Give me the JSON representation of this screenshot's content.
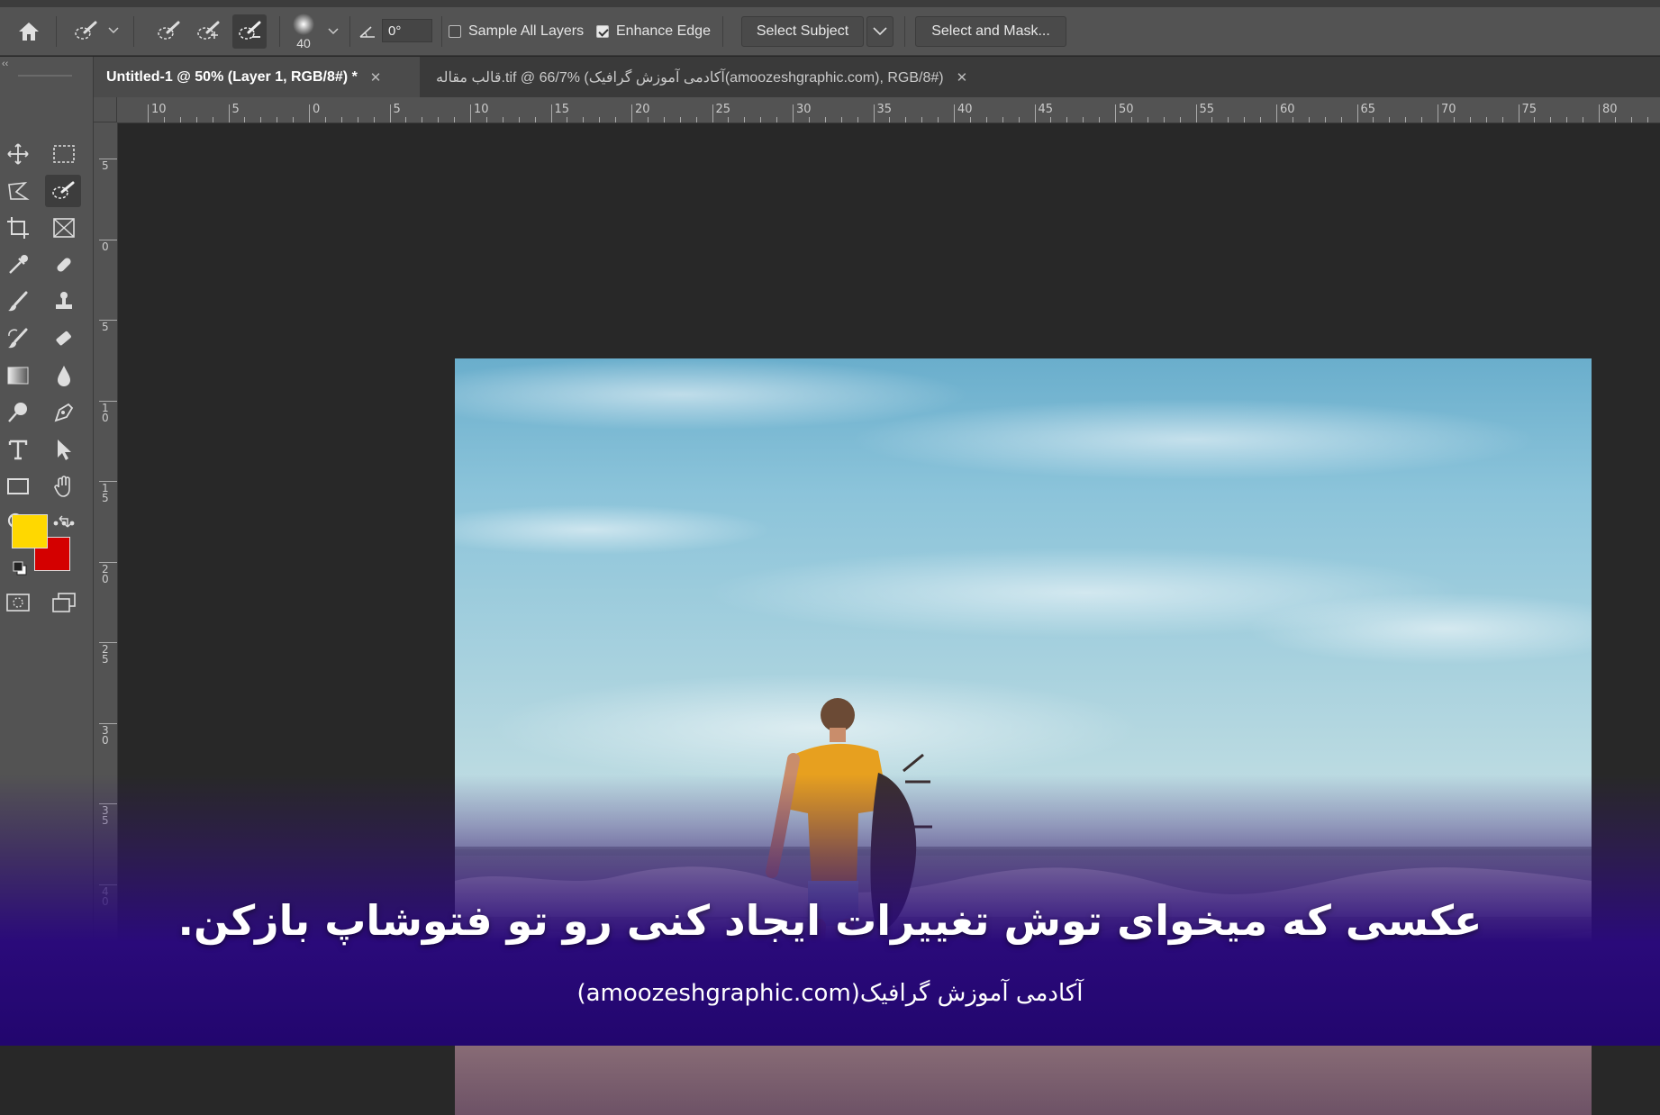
{
  "options_bar": {
    "brush_size": "40",
    "angle_value": "0°",
    "sample_all_layers_label": "Sample All Layers",
    "sample_all_layers_checked": false,
    "enhance_edge_label": "Enhance Edge",
    "enhance_edge_checked": true,
    "select_subject_label": "Select Subject",
    "select_and_mask_label": "Select and Mask..."
  },
  "tabs": [
    {
      "label": "Untitled-1 @ 50% (Layer 1, RGB/8#) *",
      "active": true
    },
    {
      "label": "قالب مقاله.tif @ 66/7% (آکادمی آموزش گرافیک(amoozeshgraphic.com), RGB/8#)",
      "active": false
    }
  ],
  "ruler_h": [
    "10",
    "5",
    "0",
    "5",
    "10",
    "15",
    "20",
    "25",
    "30",
    "35",
    "40",
    "45",
    "50",
    "55",
    "60",
    "65",
    "70",
    "75",
    "80"
  ],
  "ruler_v": [
    "5",
    "0",
    "5",
    "10",
    "15",
    "20",
    "25",
    "30",
    "35",
    "40"
  ],
  "colors": {
    "foreground": "#ffd800",
    "background": "#d40000",
    "overlay": "#2a0a7a"
  },
  "caption": {
    "main": "عکسی که میخوای توش تغییرات ایجاد کنی رو تو فتوشاپ بازکن.",
    "sub": "آکادمی آموزش گرافیک(amoozeshgraphic.com)"
  }
}
